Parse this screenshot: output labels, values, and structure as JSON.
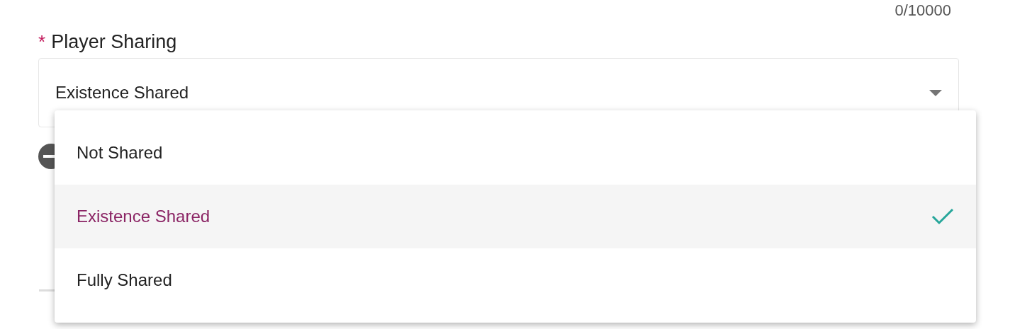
{
  "counter": "0/10000",
  "field": {
    "required_mark": "*",
    "label": "Player Sharing",
    "value": "Existence Shared",
    "expanded": true
  },
  "options": [
    {
      "label": "Not Shared",
      "selected": false
    },
    {
      "label": "Existence Shared",
      "selected": true
    },
    {
      "label": "Fully Shared",
      "selected": false
    }
  ]
}
